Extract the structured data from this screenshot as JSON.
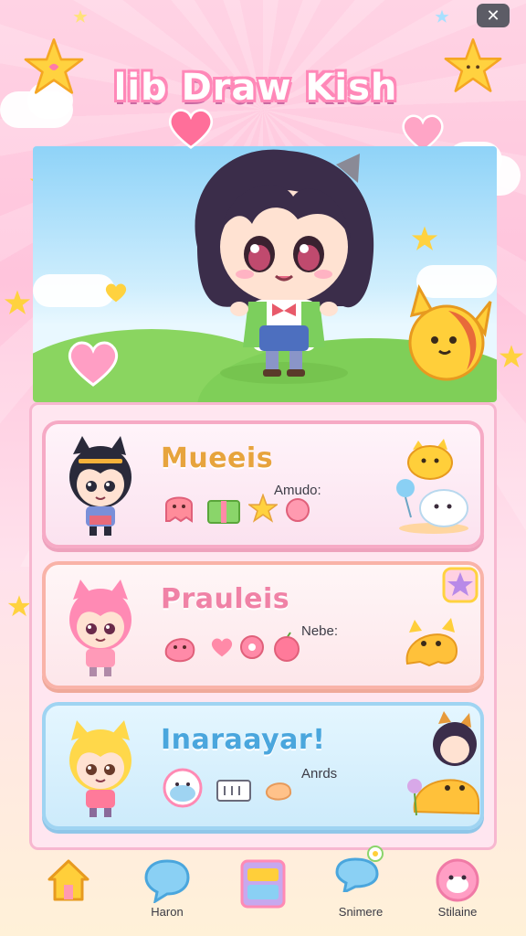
{
  "app": {
    "title": "lib Draw Kish",
    "close_label": "✕"
  },
  "cards": [
    {
      "title": "Mueeis",
      "subtitle": "Amudo:"
    },
    {
      "title": "Prauleis",
      "subtitle": "Nebe:"
    },
    {
      "title": "Inaraayar!",
      "subtitle": "Anrds"
    }
  ],
  "nav": [
    {
      "label": "",
      "icon": "home-icon"
    },
    {
      "label": "Haron",
      "icon": "chat-bubble-icon"
    },
    {
      "label": "",
      "icon": "book-icon"
    },
    {
      "label": "Snimere",
      "icon": "flower-chat-icon"
    },
    {
      "label": "Stilaine",
      "icon": "pig-face-icon"
    }
  ],
  "colors": {
    "accent_pink": "#ff88b8",
    "card1_title": "#e7a43d",
    "card2_title": "#f082a6",
    "card3_title": "#4aa6dd"
  }
}
